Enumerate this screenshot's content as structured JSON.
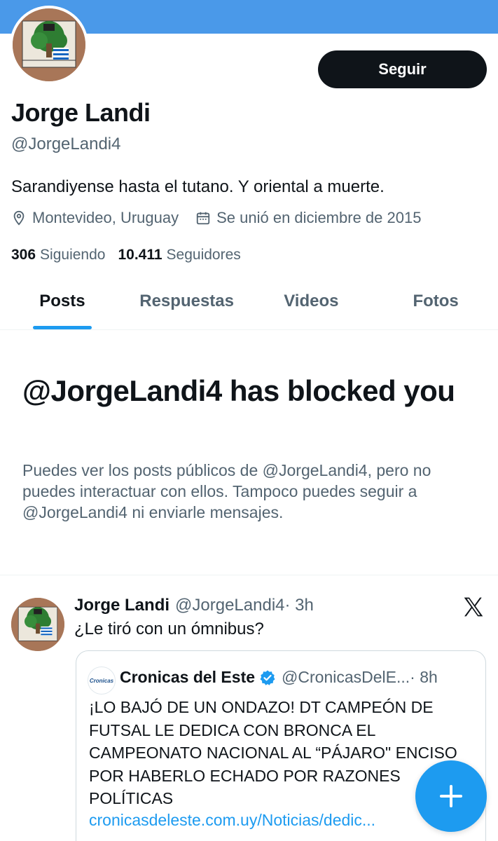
{
  "profile": {
    "name": "Jorge Landi",
    "handle": "@JorgeLandi4",
    "bio": "Sarandiyense hasta el tutano. Y oriental a muerte.",
    "location": "Montevideo, Uruguay",
    "joined": "Se unió en diciembre de 2015",
    "following_count": "306",
    "following_label": "Siguiendo",
    "followers_count": "10.411",
    "followers_label": "Seguidores",
    "follow_button": "Seguir"
  },
  "tabs": [
    {
      "label": "Posts",
      "active": true
    },
    {
      "label": "Respuestas",
      "active": false
    },
    {
      "label": "Videos",
      "active": false
    },
    {
      "label": "Fotos",
      "active": false
    }
  ],
  "blocked": {
    "title": "@JorgeLandi4 has blocked you",
    "message": "Puedes ver los posts públicos de @JorgeLandi4, pero no puedes interactuar con ellos. Tampoco puedes seguir a @JorgeLandi4 ni enviarle mensajes."
  },
  "post": {
    "author": "Jorge Landi",
    "handle": "@JorgeLandi4",
    "time": "· 3h",
    "text": "¿Le tiró con un ómnibus?",
    "quote": {
      "logo_text": "Cronicas",
      "author": "Cronicas del Este",
      "handle": "@CronicasDelE...",
      "time": "· 8h",
      "text": "¡LO BAJÓ DE UN ONDAZO! DT CAMPEÓN DE FUTSAL LE DEDICA CON BRONCA EL CAMPEONATO NACIONAL AL “PÁJARO\" ENCISO POR HABERLO ECHADO POR RAZONES POLÍTICAS",
      "link": "cronicasdeleste.com.uy/Noticias/dedic..."
    }
  },
  "colors": {
    "banner": "#4a99e9",
    "accent": "#1d9bf0",
    "text_primary": "#0f1419",
    "text_secondary": "#536471"
  },
  "icons": {
    "location": "location-pin-icon",
    "calendar": "calendar-icon",
    "verified": "verified-badge-icon",
    "x_logo": "x-logo-icon",
    "compose": "plus-icon"
  }
}
